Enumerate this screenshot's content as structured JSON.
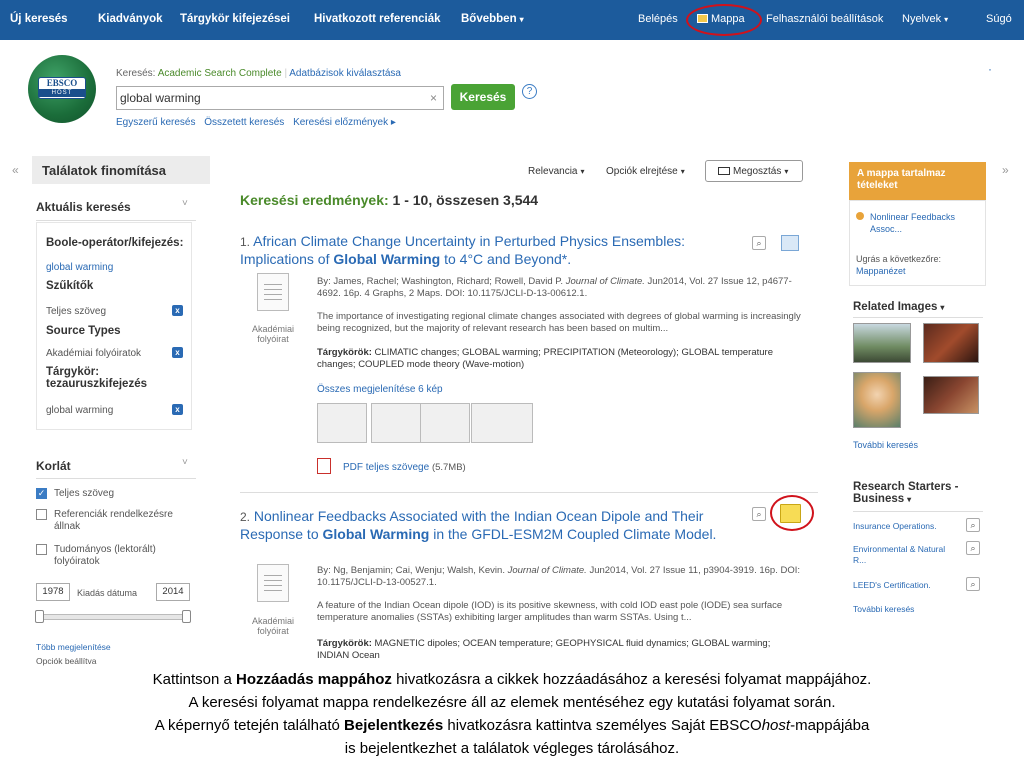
{
  "nav": {
    "items": [
      "Új keresés",
      "Kiadványok",
      "Tárgykör kifejezései",
      "Hivatkozott referenciák",
      "Bővebben"
    ],
    "right": [
      "Belépés",
      "Mappa",
      "Felhasználói beállítások",
      "Nyelvek",
      "Súgó"
    ],
    "caret": "▾"
  },
  "logo": {
    "line1": "EBSCO",
    "line2": "HOST"
  },
  "search": {
    "db_prefix": "Keresés:",
    "db_name": "Academic Search Complete",
    "db_choose": "Adatbázisok kiválasztása",
    "value": "global warming",
    "button": "Keresés",
    "help": "?",
    "links": [
      "Egyszerű keresés",
      "Összetett keresés",
      "Keresési előzmények ▸"
    ],
    "dot": "·"
  },
  "left": {
    "collapse": "«",
    "title": "Találatok finomítása",
    "current_search": "Aktuális keresés",
    "boole_label": "Boole-operátor/kifejezés:",
    "boole_value": "global warming",
    "limiters": "Szűkítők",
    "limiter_value": "Teljes szöveg",
    "source_types": "Source Types",
    "source_value": "Akadémiai folyóiratok",
    "subject_label": "Tárgykör: tezauruszkifejezés",
    "subject_value": "global warming",
    "limit_title": "Korlát",
    "check1": "Teljes szöveg",
    "check2": "Referenciák rendelkezésre állnak",
    "check3": "Tudományos (lektorált) folyóiratok",
    "date_from": "1978",
    "date_label": "Kiadás dátuma",
    "date_to": "2014",
    "more": "Több megjelenítése",
    "options": "Opciók beállítva",
    "x": "x",
    "chevron": "˅"
  },
  "results": {
    "toolbar": [
      "Relevancia",
      "Opciók elrejtése",
      "Megosztás"
    ],
    "heading_prefix": "Keresési eredmények:",
    "heading_count": "1 - 10, összesen 3,544",
    "r1": {
      "num": "1.",
      "title_a": "African Climate Change Uncertainty in Perturbed Physics Ensembles: Implications of",
      "title_b": "Global Warming",
      "title_c": "to 4°C and Beyond*.",
      "by": "By: James, Rachel; Washington, Richard; Rowell, David P.",
      "journal": "Journal of Climate.",
      "source": "Jun2014, Vol. 27 Issue 12, p4677-4692. 16p. 4 Graphs, 2 Maps. DOI: 10.1175/JCLI-D-13-00612.1.",
      "abstract": "The importance of investigating regional climate changes associated with degrees of global warming is increasingly being recognized, but the majority of relevant research has been based on multim...",
      "subjects_label": "Tárgykörök:",
      "subjects": "CLIMATIC changes; GLOBAL warming; PRECIPITATION (Meteorology); GLOBAL temperature changes; COUPLED mode theory (Wave-motion)",
      "show_images": "Összes megjelenítése 6 kép",
      "pdf": "PDF teljes szövege",
      "pdf_size": "(5.7MB)",
      "type": "Akadémiai folyóirat"
    },
    "r2": {
      "num": "2.",
      "title_a": "Nonlinear Feedbacks Associated with the Indian Ocean Dipole and Their Response to",
      "title_b": "Global Warming",
      "title_c": "in the GFDL-ESM2M Coupled Climate Model.",
      "by": "By: Ng, Benjamin; Cai, Wenju; Walsh, Kevin.",
      "journal": "Journal of Climate.",
      "source": "Jun2014, Vol. 27 Issue 11, p3904-3919. 16p. DOI: 10.1175/JCLI-D-13-00527.1.",
      "abstract": "A feature of the Indian Ocean dipole (IOD) is its positive skewness, with cold IOD east pole (IODE) sea surface temperature anomalies (SSTAs) exhibiting larger amplitudes than warm SSTAs. Using t...",
      "subjects_label": "Tárgykörök:",
      "subjects": "MAGNETIC dipoles; OCEAN temperature; GEOPHYSICAL fluid dynamics; GLOBAL warming; INDIAN Ocean",
      "type": "Akadémiai folyóirat"
    }
  },
  "right": {
    "expand": "»",
    "folder_head": "A mappa tartalmaz tételeket",
    "folder_item": "Nonlinear Feedbacks Assoc...",
    "jump": "Ugrás a következőre:",
    "folder_view": "Mappanézet",
    "related_images": "Related Images",
    "more_search": "További keresés",
    "starters": "Research Starters - Business",
    "starter_links": [
      "Insurance Operations.",
      "Environmental & Natural R...",
      "LEED's Certification."
    ],
    "more_search2": "További keresés"
  },
  "caption": {
    "l1a": "Kattintson a ",
    "l1b": "Hozzáadás mappához",
    "l1c": " hivatkozásra a cikkek hozzáadásához a keresési folyamat mappájához.",
    "l2": "A keresési folyamat mappa rendelkezésre áll az elemek mentéséhez egy kutatási folyamat során.",
    "l3a": "A képernyő tetején található ",
    "l3b": "Bejelentkezés",
    "l3c": " hivatkozásra kattintva személyes Saját EBSCO",
    "l3d": "host",
    "l3e": "-mappájába",
    "l4": "is bejelentkezhet a találatok végleges tárolásához."
  }
}
